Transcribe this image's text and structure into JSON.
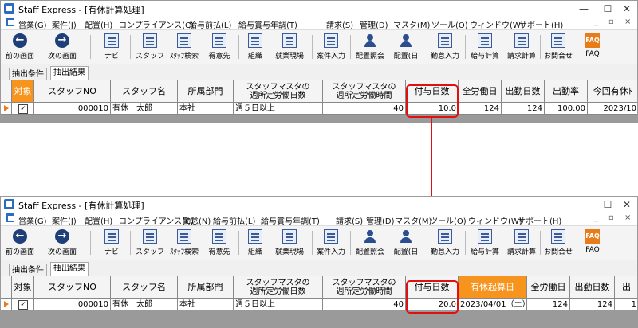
{
  "window_title": "Staff Express - [有休計算処理]",
  "window_controls": {
    "minimize": "—",
    "maximize": "☐",
    "close": "✕"
  },
  "menu_before": [
    "営業(G)",
    "案件(J)",
    "配置(H)",
    "コンプライアンス(C)",
    "給与前払(L)",
    "給与賞与年調(T)",
    "請求(S)",
    "管理(D)",
    "マスタ(M)",
    "ツール(O)",
    "ウィンドウ(W)",
    "サポート(H)"
  ],
  "menu_after": [
    "営業(G)",
    "案件(J)",
    "配置(H)",
    "コンプライアンス(C)",
    "勤怠(N)",
    "給与前払(L)",
    "給与賞与年調(T)",
    "請求(S)",
    "管理(D)",
    "マスタ(M)",
    "ツール(O)",
    "ウィンドウ(W)",
    "サポート(H)"
  ],
  "mdi_controls": {
    "minimize": "_",
    "restore": "▫",
    "close": "×"
  },
  "toolbar": {
    "back": "前の画面",
    "forward": "次の画面",
    "navi": "ナビ",
    "staff": "スタッフ",
    "staff_search": "ｽﾀｯﾌ検索",
    "client": "得意先",
    "org": "組織",
    "workplace": "就業現場",
    "case_input": "案件入力",
    "placement_query": "配置照会",
    "placement_day": "配置(日",
    "attendance_input": "勤怠入力",
    "payroll": "給与計算",
    "billing": "請求計算",
    "contact": "お問合せ",
    "faq": "FAQ",
    "faq_icon_text": "FAQ"
  },
  "tabs": {
    "conditions": "抽出条件",
    "results": "抽出結果"
  },
  "headers_before": {
    "target": "対象",
    "staff_no": "スタッフNO",
    "staff_name": "スタッフ名",
    "dept": "所属部門",
    "days_line1": "スタッフマスタの",
    "days_line2": "週所定労働日数",
    "hours_line1": "スタッフマスタの",
    "hours_line2": "週所定労働時間",
    "grant_days": "付与日数",
    "total_days": "全労働日",
    "attend_days": "出勤日数",
    "attend_rate": "出勤率",
    "next_leave": "今回有休ﾄ"
  },
  "row_before": {
    "checked": "✓",
    "staff_no": "000010",
    "staff_name": "有休　太郎",
    "dept": "本社",
    "weekly_days": "週５日以上",
    "weekly_hours": "40",
    "grant_days": "10.0",
    "total_days": "124",
    "attend_days": "124",
    "attend_rate": "100.00",
    "next_leave": "2023/10"
  },
  "headers_after": {
    "target": "対象",
    "staff_no": "スタッフNO",
    "staff_name": "スタッフ名",
    "dept": "所属部門",
    "days_line1": "スタッフマスタの",
    "days_line2": "週所定労働日数",
    "hours_line1": "スタッフマスタの",
    "hours_line2": "週所定労働時間",
    "grant_days": "付与日数",
    "leave_start": "有休起算日",
    "total_days": "全労働日",
    "attend_days": "出勤日数",
    "extra": "出"
  },
  "row_after": {
    "checked": "✓",
    "staff_no": "000010",
    "staff_name": "有休　太郎",
    "dept": "本社",
    "weekly_days": "週５日以上",
    "weekly_hours": "40",
    "grant_days": "20.0",
    "leave_start": "2023/04/01（土）",
    "total_days": "124",
    "attend_days": "124",
    "extra": "1"
  },
  "colors": {
    "highlight_box": "#e01010",
    "orange_header": "#f7941d",
    "navy_icon": "#1f3f7a"
  }
}
